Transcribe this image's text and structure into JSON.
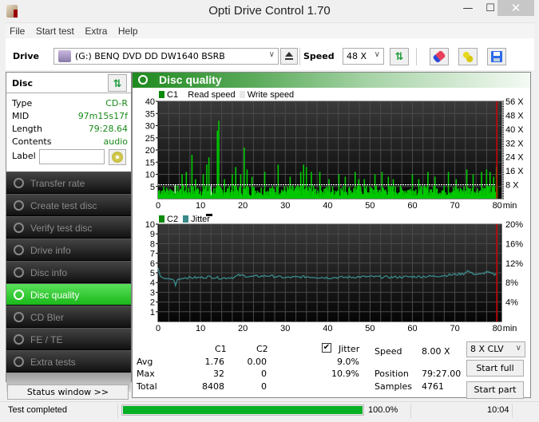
{
  "window": {
    "title": "Opti Drive Control 1.70",
    "minimize": "—",
    "maximize": "☐",
    "close": "✕"
  },
  "menu": [
    "File",
    "Start test",
    "Extra",
    "Help"
  ],
  "toolbar": {
    "drive_label": "Drive",
    "drive_value": "(G:)  BENQ DVD DD DW1640 BSRB",
    "speed_label": "Speed",
    "speed_value": "48 X",
    "icons": [
      "refresh-icon",
      "eraser-icon",
      "settings-icon",
      "save-icon"
    ]
  },
  "disc": {
    "title": "Disc",
    "rows": [
      {
        "key": "Type",
        "value": "CD-R"
      },
      {
        "key": "MID",
        "value": "97m15s17f"
      },
      {
        "key": "Length",
        "value": "79:28.64"
      },
      {
        "key": "Contents",
        "value": "audio"
      }
    ],
    "label_key": "Label",
    "label_value": ""
  },
  "nav": [
    {
      "label": "Transfer rate",
      "active": false
    },
    {
      "label": "Create test disc",
      "active": false
    },
    {
      "label": "Verify test disc",
      "active": false
    },
    {
      "label": "Drive info",
      "active": false
    },
    {
      "label": "Disc info",
      "active": false
    },
    {
      "label": "Disc quality",
      "active": true
    },
    {
      "label": "CD Bler",
      "active": false
    },
    {
      "label": "FE / TE",
      "active": false
    },
    {
      "label": "Extra tests",
      "active": false
    }
  ],
  "status_window_button": "Status window >>",
  "main": {
    "title": "Disc quality",
    "legend_top": {
      "c1": "C1",
      "read": "Read speed",
      "write": "Write speed"
    },
    "legend_bottom": {
      "c2": "C2",
      "jitter": "Jitter"
    }
  },
  "colors": {
    "c1": "#00c800",
    "c2": "#008000",
    "jitter": "#3a8a8a",
    "read_speed": "#ffffff",
    "accent_green": "#1a8a1a",
    "end_marker": "#d00000"
  },
  "chart_data": [
    {
      "type": "bar",
      "title": "C1 / Read speed",
      "x_ticks": [
        0,
        10,
        20,
        30,
        40,
        50,
        60,
        70,
        80
      ],
      "xlabel": "min",
      "xlim": [
        0,
        81
      ],
      "y_ticks": [
        5,
        10,
        15,
        20,
        25,
        30,
        35,
        40
      ],
      "ylim": [
        0,
        40
      ],
      "y2_ticks": [
        "8 X",
        "16 X",
        "24 X",
        "32 X",
        "40 X",
        "48 X",
        "56 X"
      ],
      "y2lim": [
        0,
        56
      ],
      "grid": true,
      "legend": "top-left",
      "series": [
        {
          "name": "C1",
          "note": "spiky error counts, baseline ~2-5, max 32 near 14 min",
          "peaks": [
            [
              3.5,
              3
            ],
            [
              5.5,
              10
            ],
            [
              6.5,
              11
            ],
            [
              7.8,
              18
            ],
            [
              8.6,
              8
            ],
            [
              10.5,
              10
            ],
            [
              11.3,
              14
            ],
            [
              11.8,
              17
            ],
            [
              13.8,
              28
            ],
            [
              14.1,
              32
            ],
            [
              15.5,
              8
            ],
            [
              17.4,
              10
            ],
            [
              18.1,
              13
            ],
            [
              19.3,
              10
            ],
            [
              20.2,
              21
            ],
            [
              20.8,
              12
            ],
            [
              22,
              9
            ],
            [
              25,
              11
            ],
            [
              28.2,
              14
            ],
            [
              31,
              9
            ],
            [
              33.5,
              11
            ],
            [
              34.2,
              14
            ],
            [
              34.8,
              13
            ],
            [
              36,
              11
            ],
            [
              38,
              11
            ],
            [
              40.1,
              8
            ],
            [
              42.5,
              10
            ],
            [
              44,
              9
            ],
            [
              46.3,
              11
            ],
            [
              47.2,
              8
            ],
            [
              48.5,
              8
            ],
            [
              51,
              10
            ],
            [
              52.6,
              11
            ],
            [
              54.2,
              9
            ],
            [
              55.4,
              8
            ],
            [
              59.8,
              10
            ],
            [
              61.3,
              8
            ],
            [
              63.5,
              11
            ],
            [
              65.2,
              9
            ],
            [
              68.3,
              11
            ],
            [
              70.2,
              8
            ],
            [
              72.7,
              12
            ],
            [
              74.1,
              10
            ],
            [
              76.1,
              11
            ],
            [
              77.3,
              12
            ],
            [
              78.1,
              11
            ],
            [
              79,
              9
            ],
            [
              79.6,
              13
            ]
          ]
        },
        {
          "name": "Read speed",
          "value_x": 8.0,
          "unit": "X"
        }
      ]
    },
    {
      "type": "line",
      "title": "C2 / Jitter",
      "x_ticks": [
        0,
        10,
        20,
        30,
        40,
        50,
        60,
        70,
        80
      ],
      "xlabel": "min",
      "xlim": [
        0,
        81
      ],
      "y_ticks": [
        1,
        2,
        3,
        4,
        5,
        6,
        7,
        8,
        9,
        10
      ],
      "ylim": [
        0,
        10
      ],
      "y2_ticks": [
        "4%",
        "8%",
        "12%",
        "16%",
        "20%"
      ],
      "y2lim": [
        0,
        20
      ],
      "grid": true,
      "legend": "top-left",
      "series": [
        {
          "name": "C2",
          "values": []
        },
        {
          "name": "Jitter",
          "unit": "%",
          "points": [
            [
              0,
              11
            ],
            [
              0.5,
              9.3
            ],
            [
              1.5,
              8.8
            ],
            [
              3,
              8.8
            ],
            [
              3.8,
              8.3
            ],
            [
              4.1,
              7.3
            ],
            [
              4.5,
              8.6
            ],
            [
              6,
              9.0
            ],
            [
              10,
              9.0
            ],
            [
              12,
              9.2
            ],
            [
              15,
              8.9
            ],
            [
              18,
              9.1
            ],
            [
              19,
              9.5
            ],
            [
              22,
              9.2
            ],
            [
              26,
              9.4
            ],
            [
              30,
              9.0
            ],
            [
              35,
              9.2
            ],
            [
              40,
              9.0
            ],
            [
              45,
              9.1
            ],
            [
              50,
              9.2
            ],
            [
              55,
              9.1
            ],
            [
              60,
              9.2
            ],
            [
              65,
              9.3
            ],
            [
              68,
              9.5
            ],
            [
              72,
              9.8
            ],
            [
              73,
              10.4
            ],
            [
              74,
              9.9
            ],
            [
              76,
              9.6
            ],
            [
              77.5,
              10.2
            ],
            [
              79,
              9.7
            ],
            [
              80,
              9.6
            ]
          ]
        }
      ]
    }
  ],
  "stats": {
    "headers": [
      "C1",
      "C2"
    ],
    "jitter_label": "Jitter",
    "jitter_checked": true,
    "rows": [
      {
        "label": "Avg",
        "c1": "1.76",
        "c2": "0.00",
        "jitter": "9.0%"
      },
      {
        "label": "Max",
        "c1": "32",
        "c2": "0",
        "jitter": "10.9%"
      },
      {
        "label": "Total",
        "c1": "8408",
        "c2": "0",
        "jitter": ""
      }
    ],
    "speed_label": "Speed",
    "speed_value": "8.00 X",
    "position_label": "Position",
    "position_value": "79:27.00",
    "samples_label": "Samples",
    "samples_value": "4761",
    "clv_value": "8 X CLV",
    "start_full": "Start full",
    "start_part": "Start part"
  },
  "statusbar": {
    "text": "Test completed",
    "progress": 100.0,
    "progress_label": "100.0%",
    "time": "10:04"
  }
}
